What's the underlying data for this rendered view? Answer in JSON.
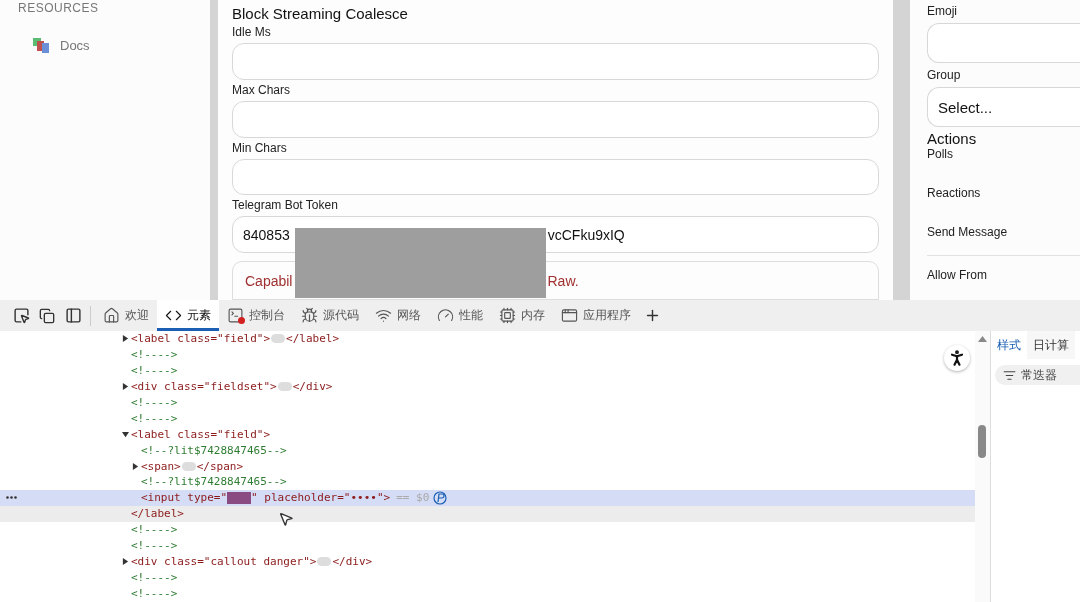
{
  "sidebar": {
    "section": "RESOURCES",
    "items": [
      {
        "label": "Docs"
      }
    ]
  },
  "form": {
    "title": "Block Streaming Coalesce",
    "fields": [
      {
        "label": "Idle Ms"
      },
      {
        "label": "Max Chars"
      },
      {
        "label": "Min Chars"
      },
      {
        "label": "Telegram Bot Token",
        "value_start": "840853",
        "value_end": "vcCFku9xIQ"
      }
    ],
    "callout": {
      "text_start": "Capabil",
      "text_end": "Raw."
    }
  },
  "side_form": {
    "fields": [
      {
        "label": "Emoji",
        "kind": "input"
      },
      {
        "label": "Group",
        "kind": "select",
        "value": "Select..."
      }
    ],
    "section": "Actions",
    "actions": [
      {
        "label": "Polls"
      },
      {
        "label": "Reactions"
      },
      {
        "label": "Send Message"
      }
    ],
    "after_divider": "Allow From"
  },
  "devtools": {
    "tabs": [
      {
        "label": "欢迎",
        "selected": false,
        "badge": false
      },
      {
        "label": "元素",
        "selected": true,
        "badge": false
      },
      {
        "label": "控制台",
        "selected": false,
        "badge": true
      },
      {
        "label": "源代码",
        "selected": false,
        "badge": false
      },
      {
        "label": "网络",
        "selected": false,
        "badge": false
      },
      {
        "label": "性能",
        "selected": false,
        "badge": false
      },
      {
        "label": "内存",
        "selected": false,
        "badge": false
      },
      {
        "label": "应用程序",
        "selected": false,
        "badge": false
      }
    ],
    "tree": [
      {
        "kind": "element",
        "open": "<label class=\"field\">",
        "close": "</label>",
        "expanded": false
      },
      {
        "kind": "comment",
        "open": "<!---->"
      },
      {
        "kind": "comment",
        "open": "<!---->"
      },
      {
        "kind": "element",
        "open": "<div class=\"fieldset\">",
        "close": "</div>",
        "expanded": false
      },
      {
        "kind": "comment",
        "open": "<!---->"
      },
      {
        "kind": "comment",
        "open": "<!---->"
      },
      {
        "kind": "element",
        "open": "<label class=\"field\">",
        "close": "</label>",
        "expanded": true,
        "close_hovered": true,
        "children": [
          {
            "kind": "comment",
            "open": "<!--?lit$7428847465-->"
          },
          {
            "kind": "element",
            "open": "<span>",
            "close": "</span>",
            "expanded": false
          },
          {
            "kind": "comment",
            "open": "<!--?lit$7428847465-->"
          },
          {
            "kind": "leaf",
            "open": "<input type=\"",
            "open_after": "\" placeholder=\"••••\">",
            "selected": true,
            "suffix": "== $0"
          }
        ]
      },
      {
        "kind": "comment",
        "open": "<!---->"
      },
      {
        "kind": "comment",
        "open": "<!---->"
      },
      {
        "kind": "element",
        "open": "<div class=\"callout danger\">",
        "close": "</div>",
        "expanded": false
      },
      {
        "kind": "comment",
        "open": "<!---->"
      },
      {
        "kind": "comment",
        "open": "<!---->"
      }
    ],
    "styles_tabs": [
      {
        "label": "样式",
        "selected": true
      },
      {
        "label": "日计算",
        "selected": false
      }
    ],
    "filter": {
      "placeholder": "常迭器"
    }
  }
}
